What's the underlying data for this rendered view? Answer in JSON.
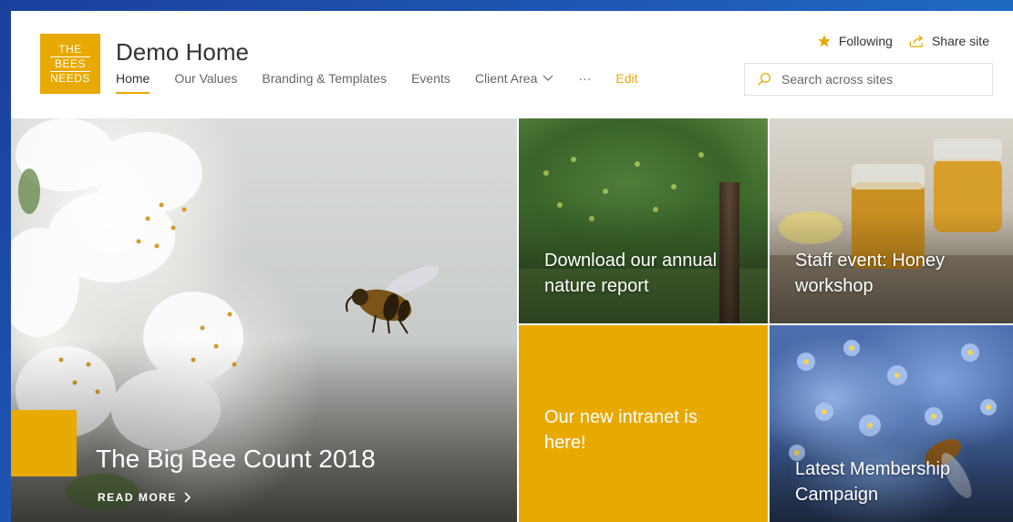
{
  "logo": {
    "line1": "THE",
    "line2": "BEES",
    "line3": "NEEDS",
    "color": "#e8a900"
  },
  "site": {
    "title": "Demo Home"
  },
  "nav": {
    "items": [
      {
        "label": "Home"
      },
      {
        "label": "Our Values"
      },
      {
        "label": "Branding & Templates"
      },
      {
        "label": "Events"
      },
      {
        "label": "Client Area"
      },
      {
        "label": "···"
      },
      {
        "label": "Edit"
      }
    ]
  },
  "actions": {
    "following": "Following",
    "share": "Share site"
  },
  "search": {
    "placeholder": "Search across sites"
  },
  "hero": {
    "title": "The Big Bee Count 2018",
    "read_more": "READ MORE"
  },
  "tiles": {
    "nature": {
      "line1": "Download our annual",
      "line2": "nature report"
    },
    "honey": {
      "line1": "Staff event: Honey",
      "line2": "workshop"
    },
    "intranet": {
      "line1": "Our new intranet is",
      "line2": "here!"
    },
    "membership": {
      "line1": "Latest Membership",
      "line2": "Campaign"
    }
  },
  "colors": {
    "accent": "#e8a900",
    "background": "#1f5bb8"
  }
}
